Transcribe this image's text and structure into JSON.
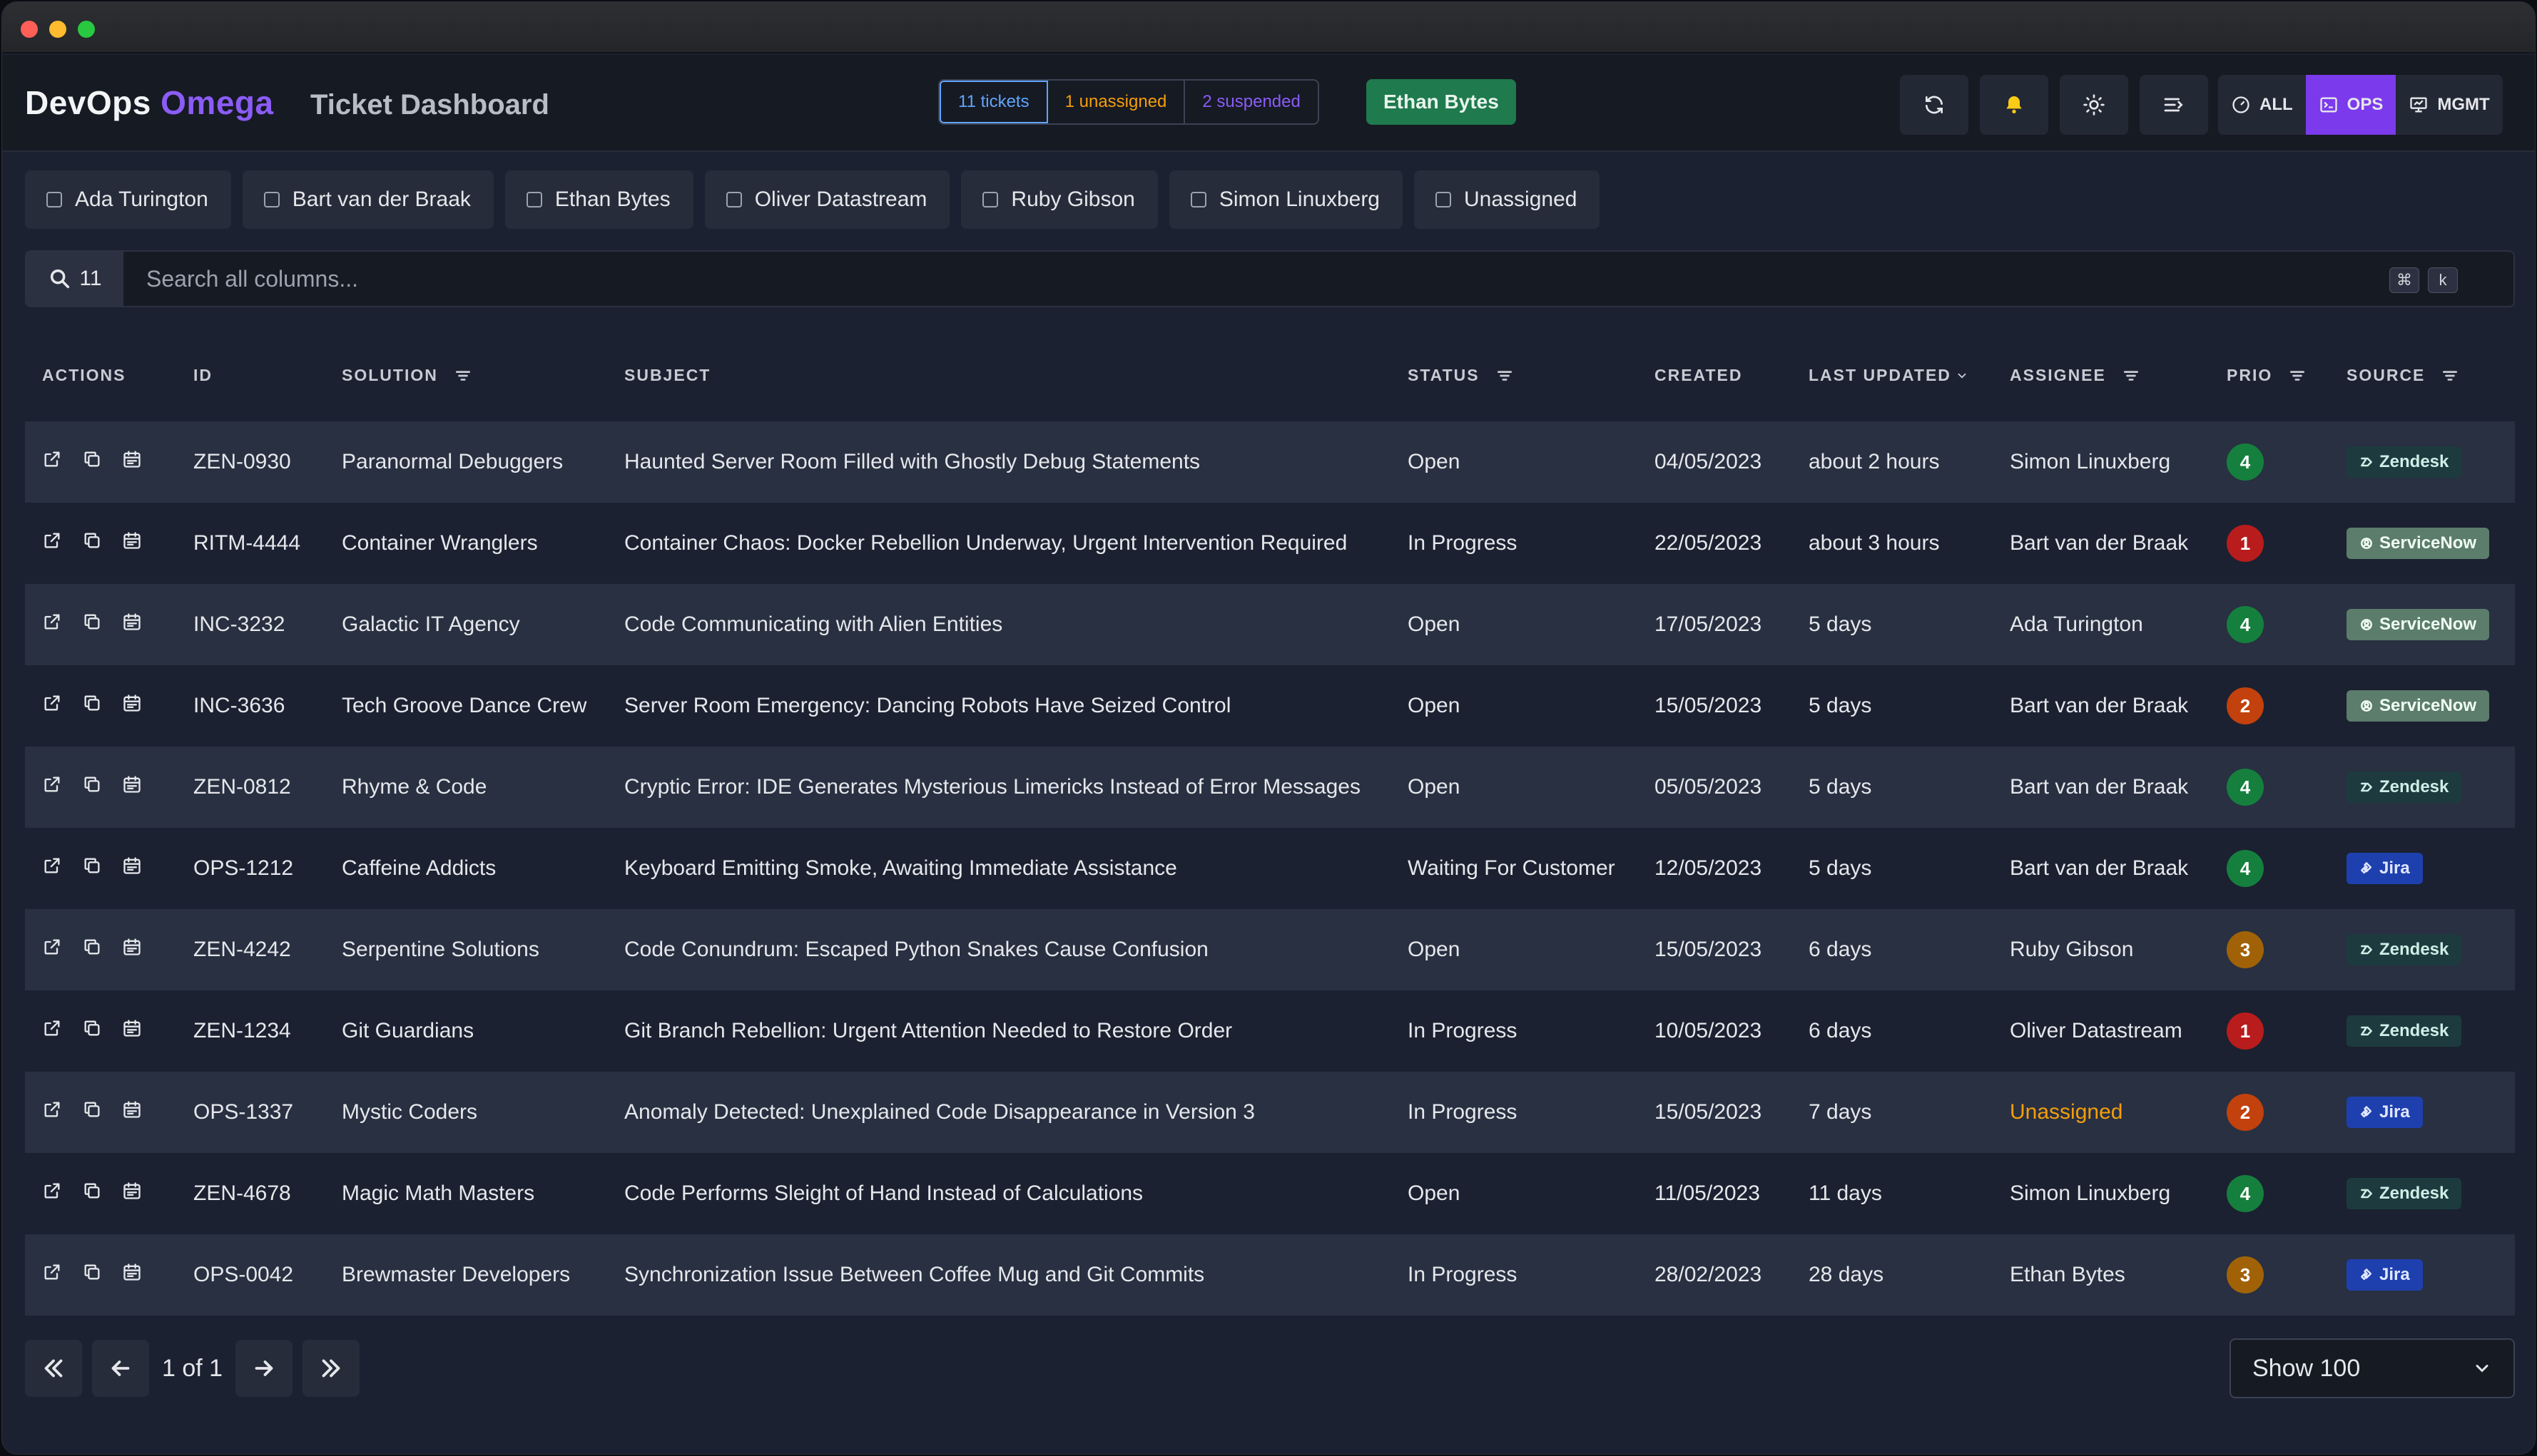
{
  "app": {
    "brand_main": "DevOps",
    "brand_accent": "Omega",
    "page_title": "Ticket Dashboard"
  },
  "counts": {
    "tickets": "11 tickets",
    "unassigned": "1 unassigned",
    "suspended": "2 suspended"
  },
  "current_user": "Ethan Bytes",
  "view_switch": {
    "all": "ALL",
    "ops": "OPS",
    "mgmt": "MGMT",
    "active": "OPS"
  },
  "assignee_filters": [
    "Ada Turington",
    "Bart van der Braak",
    "Ethan Bytes",
    "Oliver Datastream",
    "Ruby Gibson",
    "Simon Linuxberg",
    "Unassigned"
  ],
  "search": {
    "count": "11",
    "placeholder": "Search all columns...",
    "shortcut_1": "⌘",
    "shortcut_2": "k"
  },
  "columns": {
    "actions": "ACTIONS",
    "id": "ID",
    "solution": "SOLUTION",
    "subject": "SUBJECT",
    "status": "STATUS",
    "created": "CREATED",
    "last_updated": "LAST UPDATED",
    "assignee": "ASSIGNEE",
    "prio": "PRIO",
    "source": "SOURCE"
  },
  "tickets": [
    {
      "id": "ZEN-0930",
      "solution": "Paranormal Debuggers",
      "subject": "Haunted Server Room Filled with Ghostly Debug Statements",
      "status": "Open",
      "created": "04/05/2023",
      "updated": "about 2 hours",
      "assignee": "Simon Linuxberg",
      "prio": "4",
      "source": "Zendesk"
    },
    {
      "id": "RITM-4444",
      "solution": "Container Wranglers",
      "subject": "Container Chaos: Docker Rebellion Underway, Urgent Intervention Required",
      "status": "In Progress",
      "created": "22/05/2023",
      "updated": "about 3 hours",
      "assignee": "Bart van der Braak",
      "prio": "1",
      "source": "ServiceNow"
    },
    {
      "id": "INC-3232",
      "solution": "Galactic IT Agency",
      "subject": "Code Communicating with Alien Entities",
      "status": "Open",
      "created": "17/05/2023",
      "updated": "5 days",
      "assignee": "Ada Turington",
      "prio": "4",
      "source": "ServiceNow"
    },
    {
      "id": "INC-3636",
      "solution": "Tech Groove Dance Crew",
      "subject": "Server Room Emergency: Dancing Robots Have Seized Control",
      "status": "Open",
      "created": "15/05/2023",
      "updated": "5 days",
      "assignee": "Bart van der Braak",
      "prio": "2",
      "source": "ServiceNow"
    },
    {
      "id": "ZEN-0812",
      "solution": "Rhyme & Code",
      "subject": "Cryptic Error: IDE Generates Mysterious Limericks Instead of Error Messages",
      "status": "Open",
      "created": "05/05/2023",
      "updated": "5 days",
      "assignee": "Bart van der Braak",
      "prio": "4",
      "source": "Zendesk"
    },
    {
      "id": "OPS-1212",
      "solution": "Caffeine Addicts",
      "subject": "Keyboard Emitting Smoke, Awaiting Immediate Assistance",
      "status": "Waiting For Customer",
      "created": "12/05/2023",
      "updated": "5 days",
      "assignee": "Bart van der Braak",
      "prio": "4",
      "source": "Jira"
    },
    {
      "id": "ZEN-4242",
      "solution": "Serpentine Solutions",
      "subject": "Code Conundrum: Escaped Python Snakes Cause Confusion",
      "status": "Open",
      "created": "15/05/2023",
      "updated": "6 days",
      "assignee": "Ruby Gibson",
      "prio": "3",
      "source": "Zendesk"
    },
    {
      "id": "ZEN-1234",
      "solution": "Git Guardians",
      "subject": "Git Branch Rebellion: Urgent Attention Needed to Restore Order",
      "status": "In Progress",
      "created": "10/05/2023",
      "updated": "6 days",
      "assignee": "Oliver Datastream",
      "prio": "1",
      "source": "Zendesk"
    },
    {
      "id": "OPS-1337",
      "solution": "Mystic Coders",
      "subject": "Anomaly Detected: Unexplained Code Disappearance in Version 3",
      "status": "In Progress",
      "created": "15/05/2023",
      "updated": "7 days",
      "assignee": "Unassigned",
      "prio": "2",
      "source": "Jira"
    },
    {
      "id": "ZEN-4678",
      "solution": "Magic Math Masters",
      "subject": "Code Performs Sleight of Hand Instead of Calculations",
      "status": "Open",
      "created": "11/05/2023",
      "updated": "11 days",
      "assignee": "Simon Linuxberg",
      "prio": "4",
      "source": "Zendesk"
    },
    {
      "id": "OPS-0042",
      "solution": "Brewmaster Developers",
      "subject": "Synchronization Issue Between Coffee Mug and Git Commits",
      "status": "In Progress",
      "created": "28/02/2023",
      "updated": "28 days",
      "assignee": "Ethan Bytes",
      "prio": "3",
      "source": "Jira"
    }
  ],
  "prio_colors": {
    "1": "#b91c1c",
    "2": "#c2410c",
    "3": "#a16207",
    "4": "#15803d"
  },
  "source_styles": {
    "Zendesk": {
      "bg": "#1d3b3f",
      "fg": "#cfeee7",
      "icon": "zendesk-icon"
    },
    "ServiceNow": {
      "bg": "#5c7c6c",
      "fg": "#f0fdf4",
      "icon": "servicenow-icon"
    },
    "Jira": {
      "bg": "#1e40af",
      "fg": "#e0e7ff",
      "icon": "jira-icon"
    }
  },
  "unassigned_color": "#f59e0b",
  "pagination": {
    "page_text": "1 of 1",
    "page_size": "Show 100"
  }
}
